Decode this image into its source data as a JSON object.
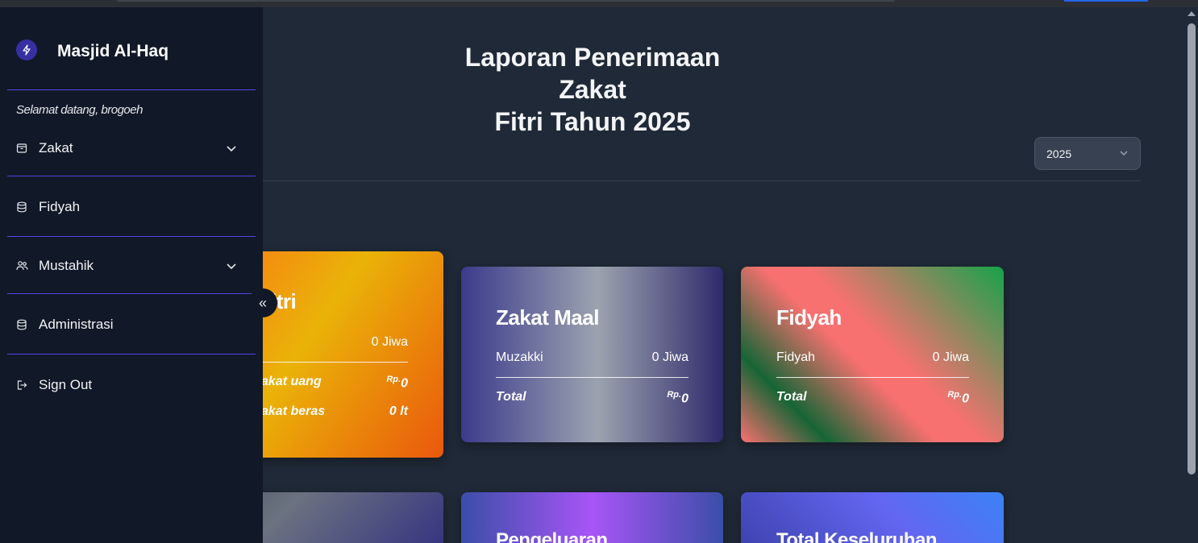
{
  "sidebar": {
    "brand": "Masjid Al-Haq",
    "brand_icon": "bolt-icon",
    "welcome": "Selamat datang, brogoeh",
    "items": [
      {
        "label": "Zakat",
        "icon": "archive-icon",
        "has_chevron": true
      },
      {
        "label": "Fidyah",
        "icon": "database-icon",
        "has_chevron": false
      },
      {
        "label": "Mustahik",
        "icon": "users-icon",
        "has_chevron": true
      },
      {
        "label": "Administrasi",
        "icon": "database-icon",
        "has_chevron": false
      },
      {
        "label": "Sign Out",
        "icon": "sign-out-icon",
        "has_chevron": false
      }
    ],
    "collapse_glyph": "«"
  },
  "header": {
    "title_line1": "Laporan Penerimaan Zakat",
    "title_line2": "Fitri Tahun 2025",
    "year_selected": "2025"
  },
  "cards": {
    "fitri": {
      "title_visible": "itri",
      "row_value": "0 Jiwa",
      "uang_label": "akat uang",
      "uang_value": "0",
      "beras_label": "akat beras",
      "beras_value": "0 lt"
    },
    "maal": {
      "title": "Zakat Maal",
      "row_label": "Muzakki",
      "row_value": "0 Jiwa",
      "total_label": "Total",
      "total_value": "0"
    },
    "fidyah": {
      "title": "Fidyah",
      "row_label": "Fidyah",
      "row_value": "0 Jiwa",
      "total_label": "Total",
      "total_value": "0"
    },
    "pengeluaran": {
      "title": "Pengeluaran"
    },
    "keseluruhan": {
      "title": "Total Keseluruhan"
    },
    "currency": "Rp."
  },
  "colors": {
    "sidebar_bg": "#111827",
    "main_bg": "#1f2937",
    "accent_line": "#4f46e5"
  }
}
